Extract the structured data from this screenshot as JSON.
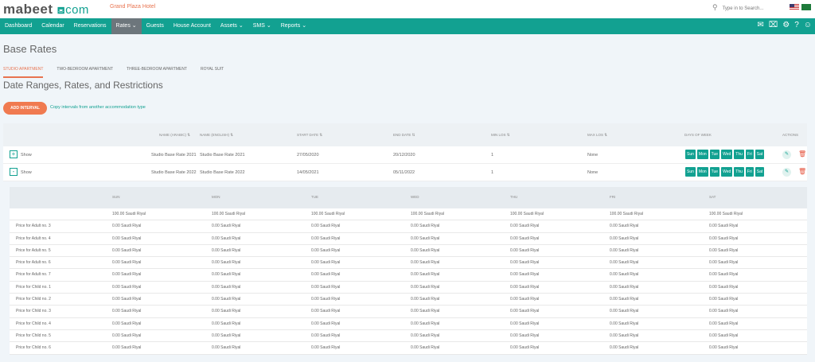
{
  "header": {
    "logo": "mabeet",
    "logo_suffix": "com",
    "hotel": "Grand Plaza Hotel",
    "search_placeholder": "Type in to Search..."
  },
  "nav": {
    "items": [
      "Dashboard",
      "Calendar",
      "Reservations",
      "Rates ⌄",
      "Guests",
      "House Account",
      "Assets ⌄",
      "SMS ⌄",
      "Reports ⌄"
    ],
    "active": 3
  },
  "page": {
    "title": "Base Rates",
    "tabs": [
      "STUDIO APARTMENT",
      "TWO-BEDROOM APARTMENT",
      "THREE-BEDROOM APARTMENT",
      "ROYAL SUIT"
    ],
    "section_title": "Date Ranges, Rates, and Restrictions",
    "add_interval": "ADD INTERVAL",
    "copy_link": "Copy intervals from another accommodation type"
  },
  "table": {
    "headers": [
      "NAME (ARABIC) ⇅",
      "NAME (ENGLISH) ⇅",
      "START DATE ⇅",
      "END DATE ⇅",
      "MIN LOS ⇅",
      "MAX LOS ⇅",
      "DAYS OF WEEK",
      "ACTIONS"
    ],
    "show_label": "Show",
    "days": [
      "Sun",
      "Mon",
      "Tue",
      "Wed",
      "Thu",
      "Fri",
      "Sat"
    ],
    "rows": [
      {
        "toggle": "+",
        "name_ar": "Studio Base Rate 2021",
        "name_en": "Studio Base Rate 2021",
        "start": "27/05/2020",
        "end": "20/12/2020",
        "min": "1",
        "max": "None"
      },
      {
        "toggle": "-",
        "name_ar": "Studio Base Rate 2022",
        "name_en": "Studio Base Rate 2022",
        "start": "14/05/2021",
        "end": "05/11/2022",
        "min": "1",
        "max": "None"
      }
    ]
  },
  "subtable": {
    "headers": [
      "SUN",
      "MON",
      "TUE",
      "WED",
      "THU",
      "FRI",
      "SAT"
    ],
    "rows": [
      {
        "label": "",
        "values": [
          "100.00 Saudi Riyal",
          "100.00 Saudi Riyal",
          "100.00 Saudi Riyal",
          "100.00 Saudi Riyal",
          "100.00 Saudi Riyal",
          "100.00 Saudi Riyal",
          "100.00 Saudi Riyal"
        ]
      },
      {
        "label": "Price for Adult no. 3",
        "values": [
          "0.00 Saudi Riyal",
          "0.00 Saudi Riyal",
          "0.00 Saudi Riyal",
          "0.00 Saudi Riyal",
          "0.00 Saudi Riyal",
          "0.00 Saudi Riyal",
          "0.00 Saudi Riyal"
        ]
      },
      {
        "label": "Price for Adult no. 4",
        "values": [
          "0.00 Saudi Riyal",
          "0.00 Saudi Riyal",
          "0.00 Saudi Riyal",
          "0.00 Saudi Riyal",
          "0.00 Saudi Riyal",
          "0.00 Saudi Riyal",
          "0.00 Saudi Riyal"
        ]
      },
      {
        "label": "Price for Adult no. 5",
        "values": [
          "0.00 Saudi Riyal",
          "0.00 Saudi Riyal",
          "0.00 Saudi Riyal",
          "0.00 Saudi Riyal",
          "0.00 Saudi Riyal",
          "0.00 Saudi Riyal",
          "0.00 Saudi Riyal"
        ]
      },
      {
        "label": "Price for Adult no. 6",
        "values": [
          "0.00 Saudi Riyal",
          "0.00 Saudi Riyal",
          "0.00 Saudi Riyal",
          "0.00 Saudi Riyal",
          "0.00 Saudi Riyal",
          "0.00 Saudi Riyal",
          "0.00 Saudi Riyal"
        ]
      },
      {
        "label": "Price for Adult no. 7",
        "values": [
          "0.00 Saudi Riyal",
          "0.00 Saudi Riyal",
          "0.00 Saudi Riyal",
          "0.00 Saudi Riyal",
          "0.00 Saudi Riyal",
          "0.00 Saudi Riyal",
          "0.00 Saudi Riyal"
        ]
      },
      {
        "label": "Price for Child no. 1",
        "values": [
          "0.00 Saudi Riyal",
          "0.00 Saudi Riyal",
          "0.00 Saudi Riyal",
          "0.00 Saudi Riyal",
          "0.00 Saudi Riyal",
          "0.00 Saudi Riyal",
          "0.00 Saudi Riyal"
        ]
      },
      {
        "label": "Price for Child no. 2",
        "values": [
          "0.00 Saudi Riyal",
          "0.00 Saudi Riyal",
          "0.00 Saudi Riyal",
          "0.00 Saudi Riyal",
          "0.00 Saudi Riyal",
          "0.00 Saudi Riyal",
          "0.00 Saudi Riyal"
        ]
      },
      {
        "label": "Price for Child no. 3",
        "values": [
          "0.00 Saudi Riyal",
          "0.00 Saudi Riyal",
          "0.00 Saudi Riyal",
          "0.00 Saudi Riyal",
          "0.00 Saudi Riyal",
          "0.00 Saudi Riyal",
          "0.00 Saudi Riyal"
        ]
      },
      {
        "label": "Price for Child no. 4",
        "values": [
          "0.00 Saudi Riyal",
          "0.00 Saudi Riyal",
          "0.00 Saudi Riyal",
          "0.00 Saudi Riyal",
          "0.00 Saudi Riyal",
          "0.00 Saudi Riyal",
          "0.00 Saudi Riyal"
        ]
      },
      {
        "label": "Price for Child no. 5",
        "values": [
          "0.00 Saudi Riyal",
          "0.00 Saudi Riyal",
          "0.00 Saudi Riyal",
          "0.00 Saudi Riyal",
          "0.00 Saudi Riyal",
          "0.00 Saudi Riyal",
          "0.00 Saudi Riyal"
        ]
      },
      {
        "label": "Price for Child no. 6",
        "values": [
          "0.00 Saudi Riyal",
          "0.00 Saudi Riyal",
          "0.00 Saudi Riyal",
          "0.00 Saudi Riyal",
          "0.00 Saudi Riyal",
          "0.00 Saudi Riyal",
          "0.00 Saudi Riyal"
        ]
      }
    ]
  },
  "colors": {
    "brand": "#12a191",
    "accent": "#f07a50",
    "danger": "#e5533d"
  }
}
